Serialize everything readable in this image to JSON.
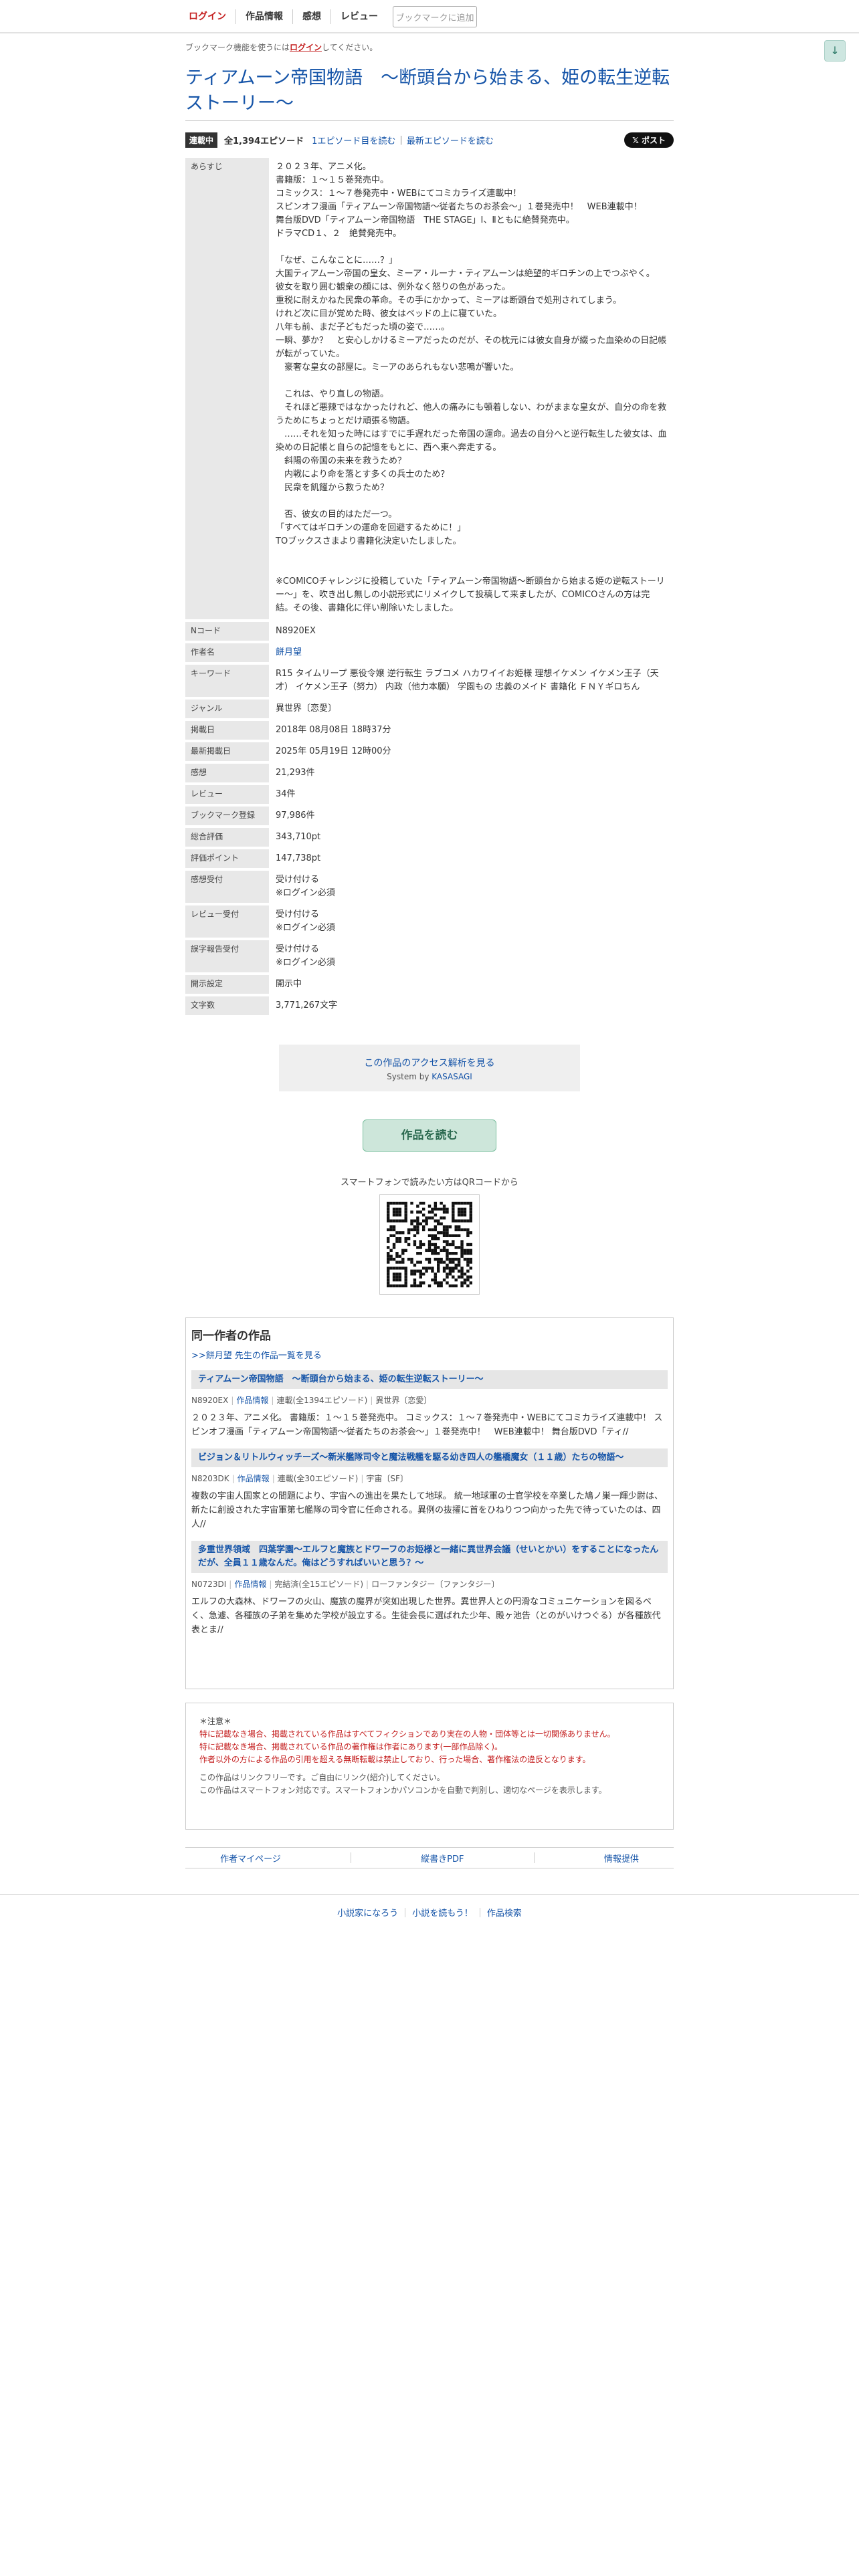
{
  "nav": {
    "items": [
      "ログイン",
      "作品情報",
      "感想",
      "レビュー"
    ],
    "bookmark_button": "ブックマークに追加"
  },
  "bookmark_note": {
    "prefix": "ブックマーク機能を使うには",
    "login": "ログイン",
    "suffix": "してください。"
  },
  "title": "ティアムーン帝国物語　～断頭台から始まる、姫の転生逆転ストーリー～",
  "episodes": {
    "badge": "連載中",
    "count": "全1,394エピソード",
    "first_link": "1エピソード目を読む",
    "latest_link": "最新エピソードを読む",
    "post_button": "𝕏 ポスト"
  },
  "info": {
    "synopsis_label": "あらすじ",
    "synopsis": "２０２３年、アニメ化。\n書籍版：１～１５巻発売中。\nコミックス：１～７巻発売中・WEBにてコミカライズ連載中！\nスピンオフ漫画「ティアムーン帝国物語～従者たちのお茶会～」１巻発売中！　WEB連載中！\n舞台版DVD「ティアムーン帝国物語　THE STAGE」Ⅰ、Ⅱともに絶賛発売中。\nドラマCD１、２　絶賛発売中。\n\n「なぜ、こんなことに……？」\n大国ティアムーン帝国の皇女、ミーア・ルーナ・ティアムーンは絶望的ギロチンの上でつぶやく。\n彼女を取り囲む観衆の顔には、例外なく怒りの色があった。\n重税に耐えかねた民衆の革命。その手にかかって、ミーアは断頭台で処刑されてしまう。\nけれど次に目が覚めた時、彼女はベッドの上に寝ていた。\n八年も前、まだ子どもだった頃の姿で……。\n一瞬、夢か？　と安心しかけるミーアだったのだが、その枕元には彼女自身が綴った血染めの日記帳が転がっていた。\n　豪奢な皇女の部屋に。ミーアのあられもない悲鳴が響いた。\n\n　これは、やり直しの物語。\n　それほど悪辣ではなかったけれど、他人の痛みにも頓着しない、わがままな皇女が、自分の命を救うためにちょっとだけ頑張る物語。\n　……それを知った時にはすでに手遅れだった帝国の運命。過去の自分へと逆行転生した彼女は、血染めの日記帳と自らの記憶をもとに、西へ東へ奔走する。\n　斜陽の帝国の未来を救うため？\n　内戦により命を落とす多くの兵士のため？\n　民衆を飢饉から救うため？\n\n　否、彼女の目的はただ一つ。\n「すべてはギロチンの運命を回避するために！」\nTOブックスさまより書籍化決定いたしました。\n\n\n※COMICOチャレンジに投稿していた「ティアムーン帝国物語～断頭台から始まる姫の逆転ストーリー～」を、吹き出し無しの小説形式にリメイクして投稿して来ましたが、COMICOさんの方は完結。その後、書籍化に伴い削除いたしました。",
    "rows": [
      {
        "label": "Nコード",
        "value": "N8920EX",
        "link": false
      },
      {
        "label": "作者名",
        "value": "餅月望",
        "link": true
      },
      {
        "label": "キーワード",
        "value": "R15 タイムリープ 悪役令嬢 逆行転生 ラブコメ ハカワイイお姫様 理想イケメン イケメン王子（天才） イケメン王子（努力） 内政（他力本願） 学園もの 忠義のメイド 書籍化 ＦＮＹギロちん",
        "link": false
      },
      {
        "label": "ジャンル",
        "value": "異世界〔恋愛〕",
        "link": false
      },
      {
        "label": "掲載日",
        "value": "2018年 08月08日 18時37分",
        "link": false
      },
      {
        "label": "最新掲載日",
        "value": "2025年 05月19日 12時00分",
        "link": false
      },
      {
        "label": "感想",
        "value": "21,293件",
        "link": false
      },
      {
        "label": "レビュー",
        "value": "34件",
        "link": false
      },
      {
        "label": "ブックマーク登録",
        "value": "97,986件",
        "link": false
      },
      {
        "label": "総合評価",
        "value": "343,710pt",
        "link": false
      },
      {
        "label": "評価ポイント",
        "value": "147,738pt",
        "link": false
      },
      {
        "label": "感想受付",
        "value": "受け付ける\n※ログイン必須",
        "link": false
      },
      {
        "label": "レビュー受付",
        "value": "受け付ける\n※ログイン必須",
        "link": false
      },
      {
        "label": "誤字報告受付",
        "value": "受け付ける\n※ログイン必須",
        "link": false
      },
      {
        "label": "開示設定",
        "value": "開示中",
        "link": false
      },
      {
        "label": "文字数",
        "value": "3,771,267文字",
        "link": false
      }
    ]
  },
  "analysis": {
    "link": "この作品のアクセス解析を見る",
    "system_prefix": "System by ",
    "system_name": "KASASAGI"
  },
  "read_button": "作品を読む",
  "qr_label": "スマートフォンで読みたい方はQRコードから",
  "same_author": {
    "title": "同一作者の作品",
    "all_link": ">>餅月望 先生の作品一覧を見る",
    "works": [
      {
        "title": "ティアムーン帝国物語　～断頭台から始まる、姫の転生逆転ストーリー～",
        "code": "N8920EX",
        "info_link": "作品情報",
        "status": "連載(全1394エピソード)",
        "genre": "異世界〔恋愛〕",
        "desc": "２０２３年、アニメ化。 書籍版：１～１５巻発売中。 コミックス：１～７巻発売中・WEBにてコミカライズ連載中！ スピンオフ漫画「ティアムーン帝国物語～従者たちのお茶会～」１巻発売中！　WEB連載中！ 舞台版DVD「ティ//"
      },
      {
        "title": "ビジョン＆リトルウィッチーズ～新米艦隊司令と魔法戦艦を駆る幼き四人の艦橋魔女（１１歳）たちの物語～",
        "code": "N8203DK",
        "info_link": "作品情報",
        "status": "連載(全30エピソード)",
        "genre": "宇宙〔SF〕",
        "desc": "複数の宇宙人国家との間題により、宇宙への進出を果たして地球。 統一地球軍の士官学校を卒業した鳩ノ巣一輝少尉は、新たに創設された宇宙軍第七艦隊の司令官に任命される。異例の抜擢に首をひねりつつ向かった先で待っていたのは、四人//"
      },
      {
        "title": "多重世界領域　四葉学園～エルフと魔族とドワーフのお姫様と一緒に異世界会議（せいとかい）をすることになったんだが、全員１１歳なんだ。俺はどうすればいいと思う？～",
        "code": "N0723DI",
        "info_link": "作品情報",
        "status": "完結済(全15エピソード)",
        "genre": "ローファンタジー〔ファンタジー〕",
        "desc": "エルフの大森林、ドワーフの火山、魔族の魔界が突如出現した世界。異世界人との円滑なコミュニケーションを図るべく、急遽、各種族の子弟を集めた学校が設立する。生徒会長に選ばれた少年、殿ヶ池告（とのがいけつぐる）が各種族代表とま//"
      }
    ]
  },
  "notice": {
    "head": "＊注意＊",
    "red_lines": [
      "特に記載なき場合、掲載されている作品はすべてフィクションであり実在の人物・団体等とは一切関係ありません。",
      "特に記載なき場合、掲載されている作品の著作権は作者にあります(一部作品除く)。",
      "作者以外の方による作品の引用を超える無断転載は禁止しており、行った場合、著作権法の違反となります。"
    ],
    "gray_lines": [
      "この作品はリンクフリーです。ご自由にリンク(紹介)してください。",
      "この作品はスマートフォン対応です。スマートフォンかパソコンかを自動で判別し、適切なページを表示します。"
    ]
  },
  "footer_links": [
    "作者マイページ",
    "縦書きPDF",
    "情報提供"
  ],
  "bottom_links": [
    "小説家になろう",
    "小説を読もう！",
    "作品検索"
  ],
  "colors": {
    "link": "#1554a8",
    "red": "#c41e1e",
    "badge": "#333333",
    "read_button_bg": "#cde6da"
  }
}
